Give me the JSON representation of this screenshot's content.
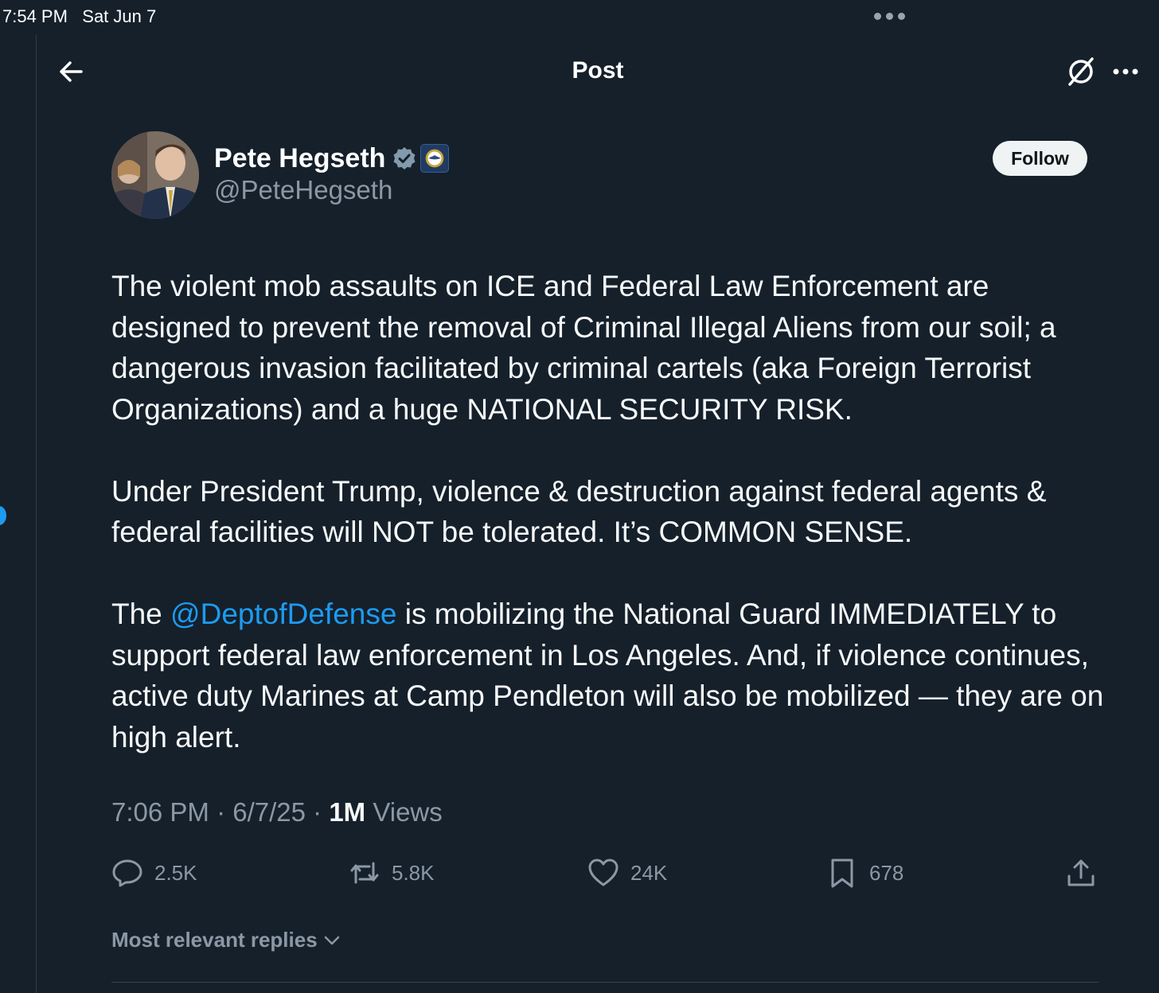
{
  "status_bar": {
    "time_date": "7:54 PM   Sat Jun 7"
  },
  "nav": {
    "title": "Post"
  },
  "author": {
    "name": "Pete Hegseth",
    "handle": "@PeteHegseth",
    "follow_label": "Follow"
  },
  "tweet": {
    "paragraph1": "The violent mob assaults on ICE and Federal Law Enforcement are designed to prevent the removal of Criminal Illegal Aliens from our soil; a dangerous invasion facilitated by criminal cartels (aka Foreign Terrorist Organizations) and a huge NATIONAL SECURITY RISK.",
    "paragraph2": "Under President Trump, violence & destruction against federal agents & federal facilities will NOT be tolerated. It’s COMMON SENSE.",
    "paragraph3_prefix": "The ",
    "paragraph3_mention": "@DeptofDefense",
    "paragraph3_rest": " is mobilizing the National Guard IMMEDIATELY to support federal law enforcement in Los Angeles. And, if violence continues, active duty Marines at Camp Pendleton will also be mobilized — they are on high alert."
  },
  "meta": {
    "timestamp": "7:06 PM · 6/7/25 · ",
    "views_count": "1M",
    "views_label": " Views"
  },
  "actions": {
    "replies": "2.5K",
    "reposts": "5.8K",
    "likes": "24K",
    "bookmarks": "678"
  },
  "replies_sort": {
    "label": "Most relevant replies"
  },
  "colors": {
    "background": "#15202b",
    "accent": "#1d9bf0",
    "secondary_text": "#8b98a5"
  }
}
